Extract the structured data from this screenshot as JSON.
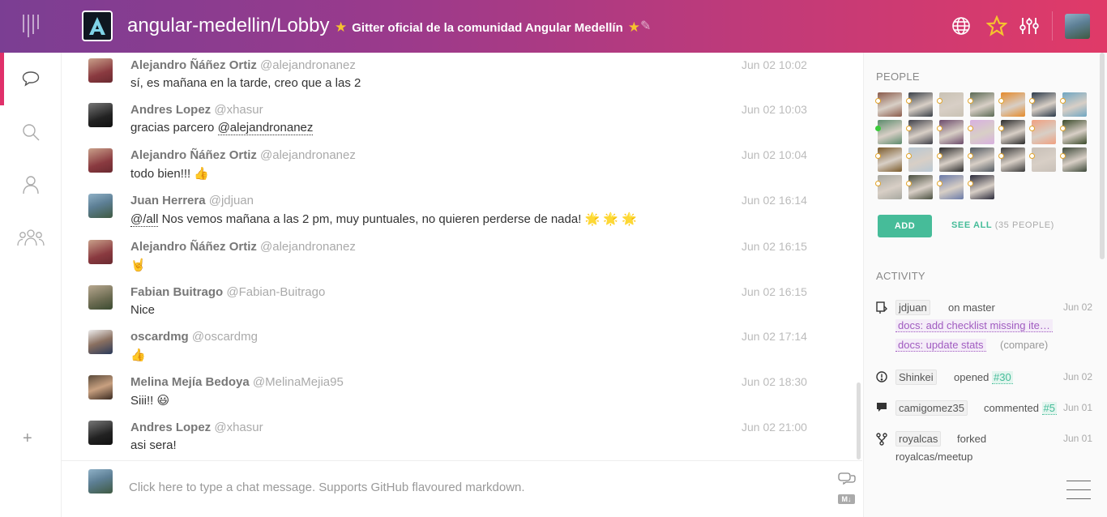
{
  "header": {
    "room_title": "angular-medellin/Lobby",
    "topic": "Gitter oficial de la comunidad Angular Medellín",
    "icons": [
      "globe-icon",
      "star-icon",
      "settings-sliders-icon"
    ]
  },
  "nav": {
    "items": [
      "chat-icon",
      "search-icon",
      "person-icon",
      "group-icon"
    ],
    "add_label": "+"
  },
  "messages": [
    {
      "name": "Alejandro Ñáñez Ortiz",
      "handle": "@alejandronanez",
      "time": "Jun 02 10:02",
      "text": "sí, es mañana en la tarde, creo que a las 2"
    },
    {
      "name": "Andres Lopez",
      "handle": "@xhasur",
      "time": "Jun 02 10:03",
      "text": "gracias parcero ",
      "mention": "@alejandronanez"
    },
    {
      "name": "Alejandro Ñáñez Ortiz",
      "handle": "@alejandronanez",
      "time": "Jun 02 10:04",
      "text": "todo bien!!! 👍"
    },
    {
      "name": "Juan Herrera",
      "handle": "@jdjuan",
      "time": "Jun 02 16:14",
      "mention_first": "@/all",
      "text": " Nos vemos mañana a las 2 pm, muy puntuales, no quieren perderse de nada! 🌟 🌟 🌟"
    },
    {
      "name": "Alejandro Ñáñez Ortiz",
      "handle": "@alejandronanez",
      "time": "Jun 02 16:15",
      "text": "🤘"
    },
    {
      "name": "Fabian Buitrago",
      "handle": "@Fabian-Buitrago",
      "time": "Jun 02 16:15",
      "text": "Nice"
    },
    {
      "name": "oscardmg",
      "handle": "@oscardmg",
      "time": "Jun 02 17:14",
      "text": "👍"
    },
    {
      "name": "Melina Mejía Bedoya",
      "handle": "@MelinaMejia95",
      "time": "Jun 02 18:30",
      "text": "Siii!! 😃"
    },
    {
      "name": "Andres Lopez",
      "handle": "@xhasur",
      "time": "Jun 02 21:00",
      "text": "asi sera!"
    }
  ],
  "input": {
    "placeholder": "Click here to type a chat message. Supports GitHub flavoured markdown.",
    "md_label": "M↓"
  },
  "people": {
    "label": "PEOPLE",
    "add_label": "ADD",
    "see_all_label": "SEE ALL",
    "see_all_count": "(35 PEOPLE)",
    "avatar_colors": [
      "#8a5a4a",
      "#3a4048",
      "#c9c2b4",
      "#5b6a54",
      "#e58a2a",
      "#2c3a4a",
      "#6fa6c2",
      "#5c8a6c",
      "#3e3f48",
      "#6b4a6a",
      "#d8b0e0",
      "#2a2a2a",
      "#f0a080",
      "#3a4a2a",
      "#7a5a2a",
      "#b8c8d4",
      "#2a2a2a",
      "#505860",
      "#3a3a3a",
      "#c8c0b8",
      "#3e4a3a",
      "#a8a8a0",
      "#4a5040",
      "#6a7aa8",
      "#2a2a3a"
    ],
    "online_index": 7
  },
  "activity": {
    "label": "ACTIVITY",
    "items": [
      {
        "icon": "repo-push-icon",
        "user": "jdjuan",
        "verb": "on master",
        "date": "Jun 02",
        "links": [
          "docs: add checklist missing ite…",
          "docs: update stats"
        ],
        "compare": "(compare)"
      },
      {
        "icon": "issue-opened-icon",
        "user": "Shinkei",
        "verb": "opened",
        "issue": "#30",
        "date": "Jun 02"
      },
      {
        "icon": "comment-icon",
        "user": "camigomez35",
        "verb": "commented",
        "issue": "#5",
        "date": "Jun 01"
      },
      {
        "icon": "fork-icon",
        "user": "royalcas",
        "verb": "forked",
        "date": "Jun 01",
        "repo": "royalcas/meetup"
      }
    ]
  }
}
